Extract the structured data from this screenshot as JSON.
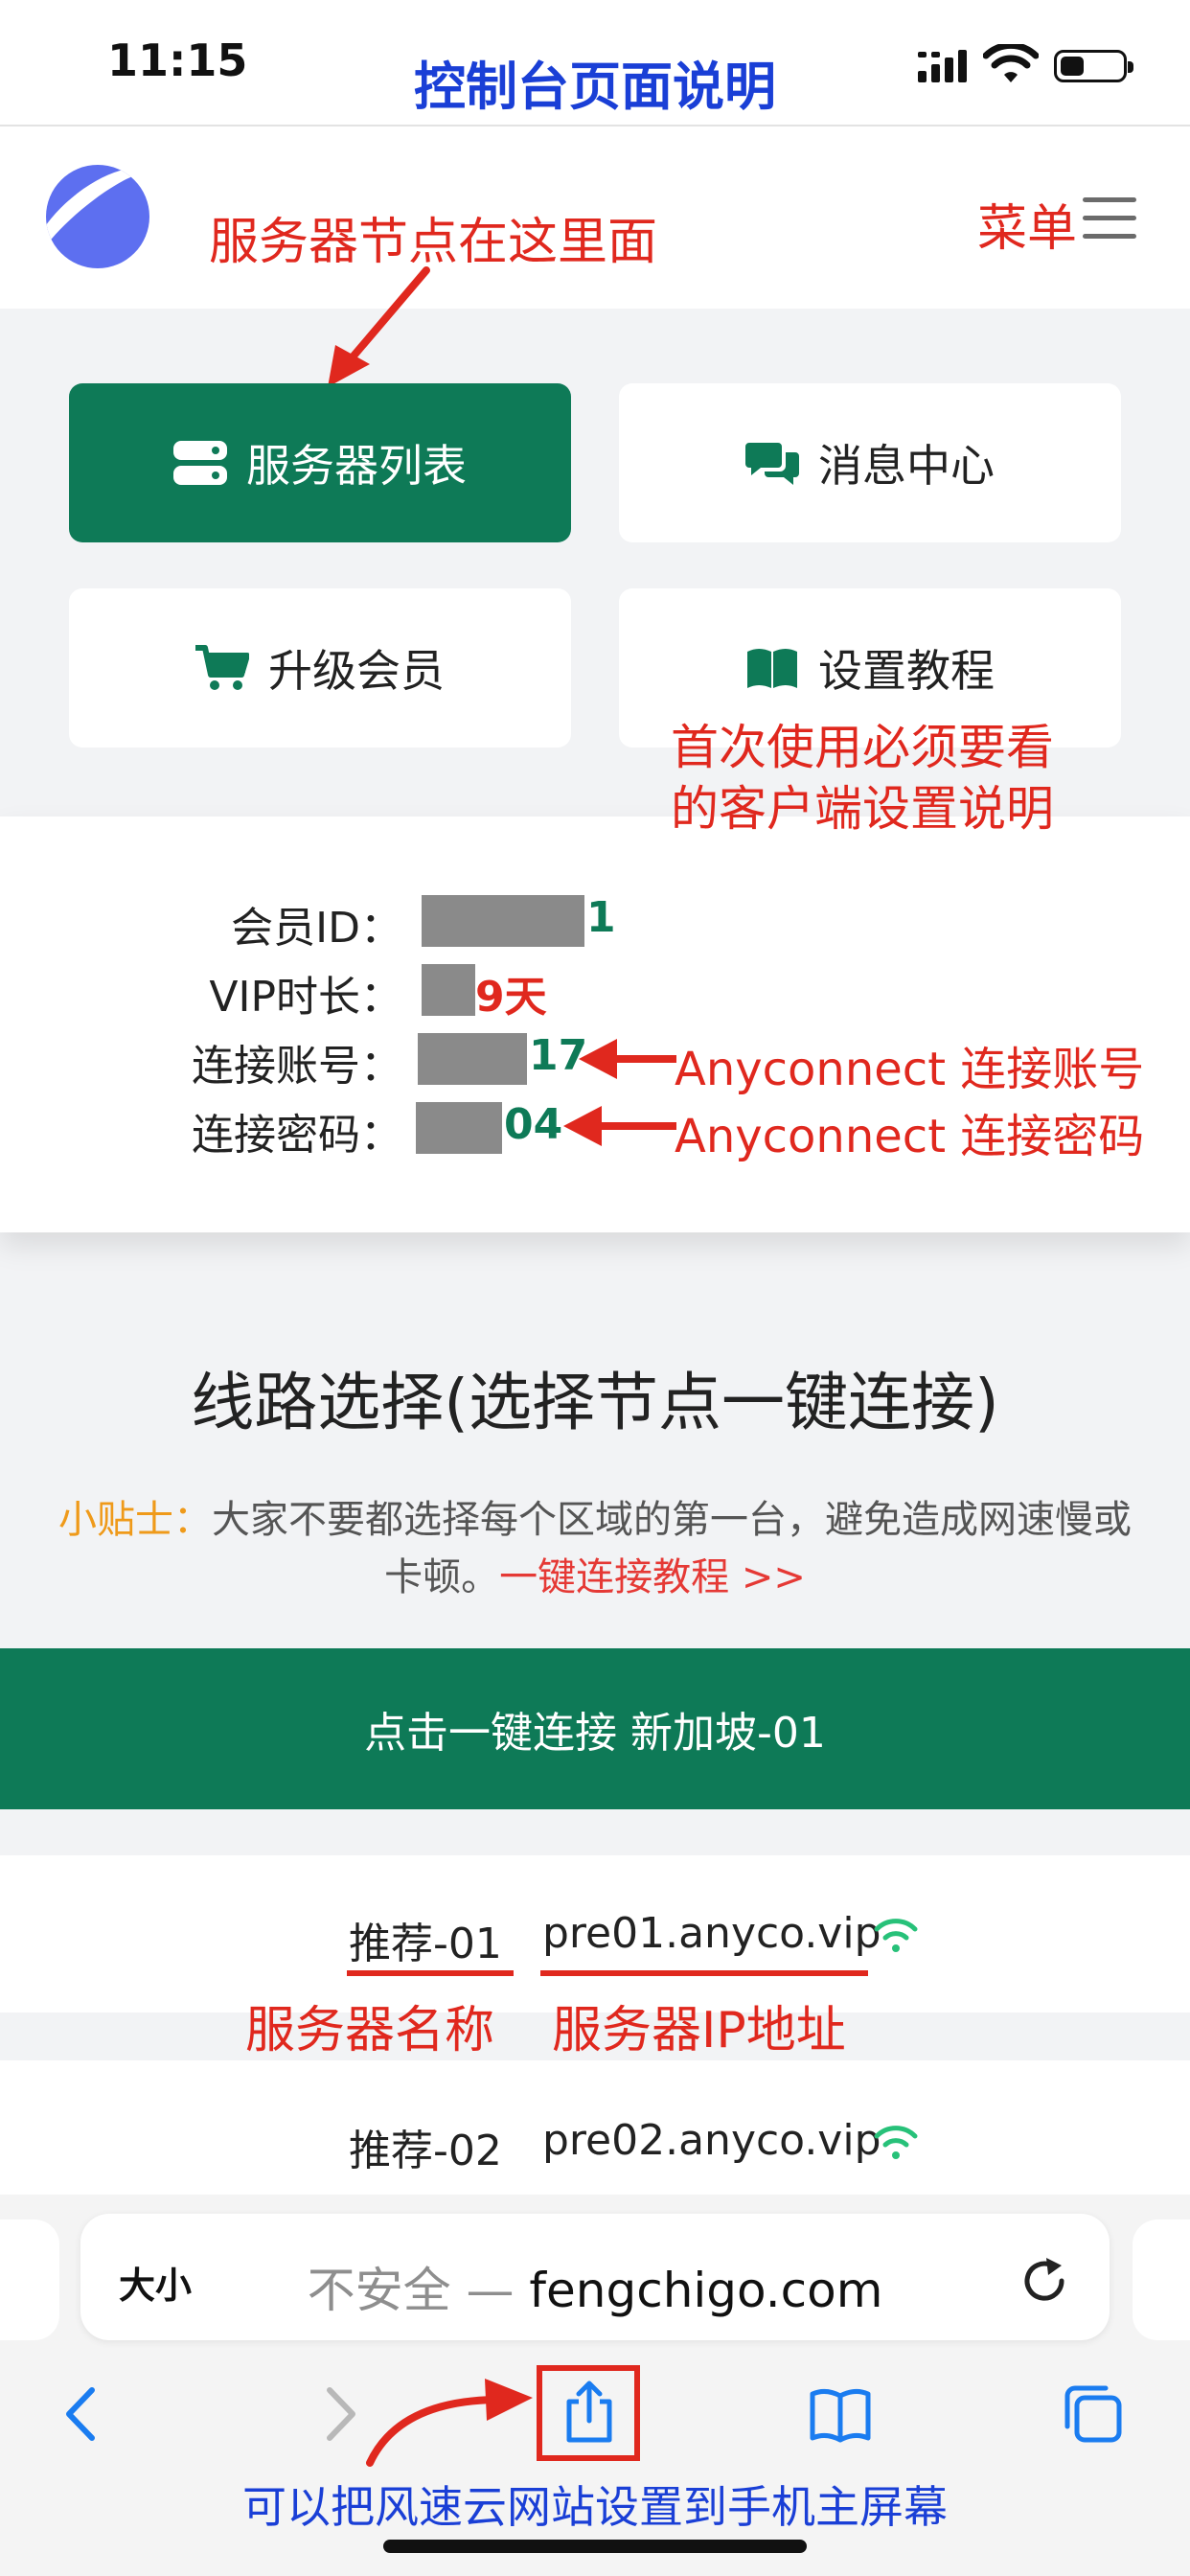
{
  "status_bar": {
    "time": "11:15"
  },
  "annotations": {
    "page_title": "控制台页面说明",
    "server_nodes_note": "服务器节点在这里面",
    "menu_note": "菜单",
    "tutorial_note_line1": "首次使用必须要看",
    "tutorial_note_line2": "的客户端设置说明",
    "account_note": "Anyconnect 连接账号",
    "password_note": "Anyconnect 连接密码",
    "server_name_note": "服务器名称",
    "server_ip_note": "服务器IP地址",
    "homescreen_note": "可以把风速云网站设置到手机主屏幕"
  },
  "cards": {
    "server_list": "服务器列表",
    "message_center": "消息中心",
    "upgrade_member": "升级会员",
    "setup_tutorial": "设置教程"
  },
  "account_info": {
    "member_id_label": "会员ID：",
    "member_id_value": "1",
    "vip_label": "VIP时长：",
    "vip_value": "9天",
    "account_label": "连接账号：",
    "account_value": "17",
    "password_label": "连接密码：",
    "password_value": "04"
  },
  "line_section": {
    "title": "线路选择(选择节点一键连接)",
    "tip_label": "小贴士：",
    "tip_text": "大家不要都选择每个区域的第一台，避免造成网速慢或卡顿。",
    "tip_link": "一键连接教程 >>",
    "connect_button": "点击一键连接 新加坡-01"
  },
  "servers": [
    {
      "name": "推荐-01",
      "host": "pre01.anyco.vip"
    },
    {
      "name": "推荐-02",
      "host": "pre02.anyco.vip"
    }
  ],
  "browser": {
    "text_size_button": "大小",
    "insecure_label": "不安全 —",
    "domain": "fengchigo.com"
  },
  "colors": {
    "brand_green": "#0e7a57",
    "annotation_red": "#e0281e",
    "annotation_blue": "#1a3fd6",
    "tip_orange": "#ef9a1a"
  }
}
